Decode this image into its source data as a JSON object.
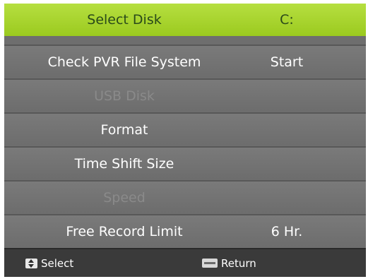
{
  "menu": {
    "rows": [
      {
        "label": "Select Disk",
        "value": "C:",
        "state": "selected"
      },
      {
        "label": "Check PVR File System",
        "value": "Start",
        "state": "normal"
      },
      {
        "label": "USB Disk",
        "value": "",
        "state": "disabled"
      },
      {
        "label": "Format",
        "value": "",
        "state": "normal"
      },
      {
        "label": "Time Shift Size",
        "value": "",
        "state": "normal"
      },
      {
        "label": "Speed",
        "value": "",
        "state": "disabled"
      },
      {
        "label": "Free Record Limit",
        "value": "6 Hr.",
        "state": "normal"
      }
    ]
  },
  "footer": {
    "select_label": "Select",
    "select_icon": "up-down-arrow-icon",
    "return_label": "Return",
    "return_icon": "menu-key-icon"
  },
  "colors": {
    "selected_row": "#a6d42c",
    "row": "#737373",
    "footer": "#3a3a3a",
    "disabled_text": "#8a8a8a"
  }
}
